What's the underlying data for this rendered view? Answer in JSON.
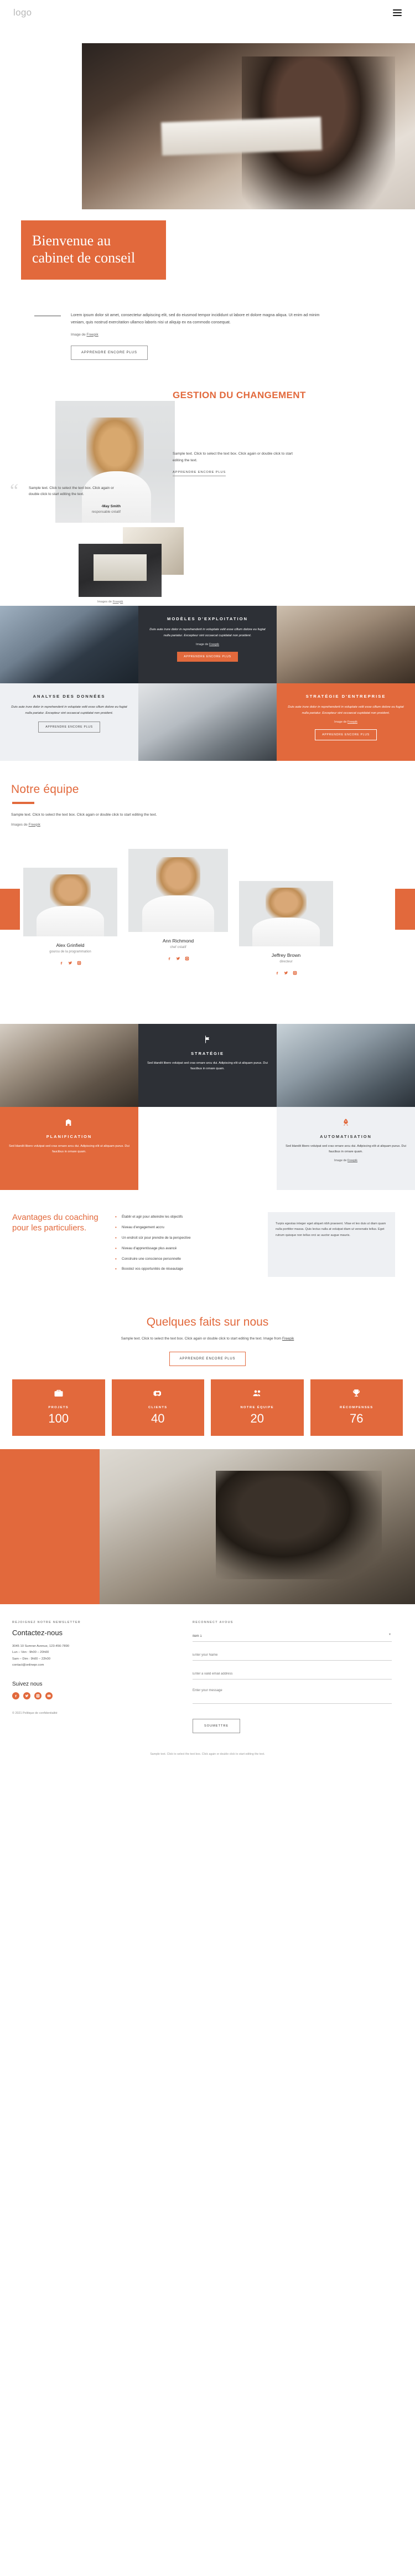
{
  "header": {
    "logo": "logo",
    "menu_icon": "hamburger-icon"
  },
  "hero": {
    "title": "Bienvenue au cabinet de conseil",
    "image_alt": "woman-working-at-desk"
  },
  "intro": {
    "paragraph": "Lorem ipsum dolor sit amet, consectetur adipiscing elit, sed do eiusmod tempor incididunt ut labore et dolore magna aliqua. Ut enim ad minim veniam, quis nostrud exercitation ullamco laboris nisi ut aliquip ex ea commodo consequat.",
    "credit_prefix": "Image de ",
    "credit_link": "Freepik",
    "button": "APPRENDRE ENCORE PLUS"
  },
  "change": {
    "title": "GESTION DU CHANGEMENT",
    "body": "Sample text. Click to select the text box. Click again or double click to start editing the text.",
    "link": "APPRENDRE ENCORE PLUS",
    "quote": "Sample text. Click to select the text box. Click again or double click to start editing the text.",
    "quote_author": "-May Smith",
    "quote_role": "responsable créatif",
    "credit_prefix": "Images de ",
    "credit_link": "Freepik"
  },
  "services": [
    {
      "kind": "photo",
      "name": "businessmen-photo"
    },
    {
      "kind": "dark",
      "title": "MODÈLES D'EXPLOITATION",
      "body": "Duis aute irure dolor in reprehenderit in voluptate velit esse cillum dolore eu fugiat nulla pariatur. Excepteur sint occaecat cupidatat non proident.",
      "credit_prefix": "Image de ",
      "credit_link": "Freepik",
      "button": "APPRENDRE ENCORE PLUS"
    },
    {
      "kind": "photo",
      "name": "office-meeting-photo"
    },
    {
      "kind": "light",
      "title": "ANALYSE DES DONNÉES",
      "body": "Duis aute irure dolor in reprehenderit in voluptate velit esse cillum dolore eu fugiat nulla pariatur. Excepteur sint occaecat cupidatat non proident.",
      "button": "APPRENDRE ENCORE PLUS"
    },
    {
      "kind": "photo",
      "name": "smiling-man-photo"
    },
    {
      "kind": "orange",
      "title": "STRATÉGIE D'ENTREPRISE",
      "body": "Duis aute irure dolor in reprehenderit in voluptate velit esse cillum dolore eu fugiat nulla pariatur. Excepteur sint occaecat cupidatat non proident.",
      "credit_prefix": "Image de ",
      "credit_link": "Freepik",
      "button": "APPRENDRE ENCORE PLUS"
    }
  ],
  "team": {
    "title": "Notre équipe",
    "body": "Sample text. Click to select the text box. Click again or double click to start editing the text.",
    "credit_prefix": "Images de ",
    "credit_link": "Freepik",
    "members": [
      {
        "name": "Alex Grinfield",
        "role": "gourou de la programmation",
        "socials": [
          "facebook-icon",
          "twitter-icon",
          "instagram-icon"
        ]
      },
      {
        "name": "Ann Richmond",
        "role": "chef créatif",
        "socials": [
          "facebook-icon",
          "twitter-icon",
          "instagram-icon"
        ]
      },
      {
        "name": "Jeffrey Brown",
        "role": "directeur",
        "socials": [
          "facebook-icon",
          "twitter-icon",
          "instagram-icon"
        ]
      }
    ]
  },
  "mosaic": {
    "strategie": {
      "icon": "flag-icon",
      "title": "STRATÉGIE",
      "body": "Sed blandit libero volutpat sed cras ornare arcu dui. Adipiscing elit ut aliquam purus. Dui faucibus in ornare quam."
    },
    "planification": {
      "icon": "building-icon",
      "title": "PLANIFICATION",
      "body": "Sed blandit libero volutpat sed cras ornare arcu dui. Adipiscing elit ut aliquam purus. Dui faucibus in ornare quam."
    },
    "automatisation": {
      "icon": "rocket-icon",
      "title": "AUTOMATISATION",
      "body": "Sed blandit libero volutpat sed cras ornare arcu dui. Adipiscing elit ut aliquam purus. Dui faucibus in ornare quam.",
      "credit_prefix": "Image de ",
      "credit_link": "Freepik"
    }
  },
  "advantages": {
    "title": "Avantages du coaching pour les particuliers.",
    "items": [
      "Établir et agir pour atteindre les objectifs",
      "Niveau d'engagement accru",
      "Un endroit sûr pour prendre de la perspective",
      "Niveau d'apprentissage plus avancé",
      "Construire une conscience personnelle",
      "Boostez vos opportunités de réseautage"
    ],
    "aside": "Turpis egestas integer eget aliquet nibh praesent. Vitae et leo duis ut diam quam nulla porttitor massa. Quis lectus nulla at volutpat diam ut venenatis tellus. Eget rutrum quisque non tellus orci ac auctor augue mauris."
  },
  "facts": {
    "title": "Quelques faits sur nous",
    "subtitle": "Sample text. Click to select the text box. Click again or double click to start editing the text. Image from ",
    "subtitle_link": "Freepik",
    "button": "APPRENDRE ENCORE PLUS",
    "stats": [
      {
        "icon": "briefcase-icon",
        "label": "PROJETS",
        "value": "100"
      },
      {
        "icon": "handshake-icon",
        "label": "CLIENTS",
        "value": "40"
      },
      {
        "icon": "people-icon",
        "label": "NOTRE ÉQUIPE",
        "value": "20"
      },
      {
        "icon": "trophy-icon",
        "label": "RÉCOMPENSES",
        "value": "76"
      }
    ]
  },
  "footer": {
    "kicker": "REJOIGNEZ NOTRE NEWSLETTER",
    "title": "Contactez-nous",
    "address_line1": "3045 10 Sumner Avenue, 123-456-7890",
    "address_line2": "Lun – Ven : 9h00 – 20h00",
    "address_line3": "Sam – Dim : 9h00 – 22h00",
    "email": "contact@onlinepr.com",
    "follow_title": "Suivez nous",
    "socials": [
      "facebook-icon",
      "twitter-icon",
      "instagram-icon",
      "youtube-icon"
    ],
    "copyright": "© 2021 Politique de confidentialité",
    "form": {
      "kicker": "RECONNECT AVOUS",
      "select_label": "Item 1",
      "select_value": "Item 1",
      "name_label": "Enter your Name",
      "name_placeholder": "",
      "email_label": "Enter a valid email address",
      "email_placeholder": "",
      "message_label": "Enter your message",
      "message_placeholder": "",
      "submit": "SOUMETTRE"
    }
  },
  "bottom_note": "Sample text. Click to select the text box. Click again or double click to start editing the text."
}
